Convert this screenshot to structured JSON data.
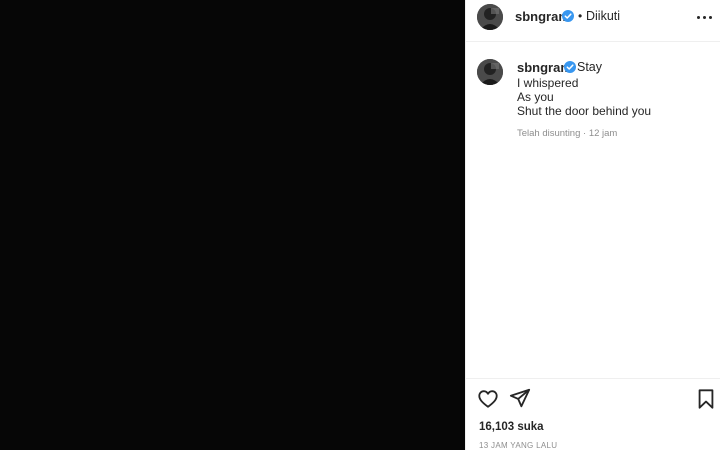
{
  "header": {
    "username": "sbngram",
    "separator": "•",
    "follow_status": "Diikuti"
  },
  "caption": {
    "username": "sbngram",
    "lines": [
      "Stay",
      "I whispered",
      "As you",
      "Shut the door behind you"
    ],
    "edited_label": "Telah disunting · 12 jam"
  },
  "footer": {
    "likes": "16,103 suka",
    "timestamp": "13 JAM YANG LALU"
  },
  "icons": {
    "verified": "verified-badge-icon",
    "more": "more-options-icon",
    "like": "heart-icon",
    "share": "paper-plane-icon",
    "save": "bookmark-icon"
  },
  "colors": {
    "verified": "#3897f0",
    "media_background": "#060606",
    "secondary_text": "#8e8e8e"
  }
}
